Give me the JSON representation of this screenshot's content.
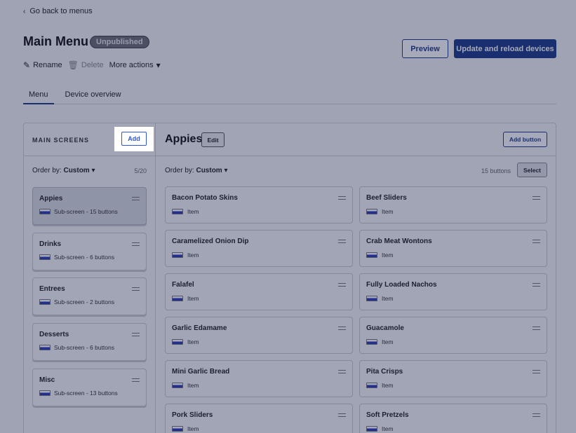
{
  "nav": {
    "back_label": "Go back to menus"
  },
  "header": {
    "title": "Main Menu",
    "status_badge": "Unpublished",
    "rename_label": "Rename",
    "delete_label": "Delete",
    "more_actions_label": "More actions",
    "preview_label": "Preview",
    "update_label": "Update and reload devices"
  },
  "tabs": [
    {
      "label": "Menu",
      "active": true
    },
    {
      "label": "Device overview",
      "active": false
    }
  ],
  "left_panel": {
    "heading": "MAIN SCREENS",
    "add_label": "Add",
    "order_prefix": "Order by:",
    "order_value": "Custom",
    "count": "5/20",
    "screens": [
      {
        "title": "Appies",
        "sub": "Sub-screen - 15 buttons",
        "selected": true
      },
      {
        "title": "Drinks",
        "sub": "Sub-screen - 6 buttons",
        "selected": false
      },
      {
        "title": "Entrees",
        "sub": "Sub-screen - 2 buttons",
        "selected": false
      },
      {
        "title": "Desserts",
        "sub": "Sub-screen - 6 buttons",
        "selected": false
      },
      {
        "title": "Misc",
        "sub": "Sub-screen - 13 buttons",
        "selected": false
      }
    ]
  },
  "right_panel": {
    "title": "Appies",
    "edit_label": "Edit",
    "add_button_label": "Add button",
    "order_prefix": "Order by:",
    "order_value": "Custom",
    "buttons_count": "15 buttons",
    "select_label": "Select",
    "items": [
      {
        "title": "Bacon Potato Skins",
        "sub": "Item"
      },
      {
        "title": "Beef Sliders",
        "sub": "Item"
      },
      {
        "title": "Caramelized Onion Dip",
        "sub": "Item"
      },
      {
        "title": "Crab Meat Wontons",
        "sub": "Item"
      },
      {
        "title": "Falafel",
        "sub": "Item"
      },
      {
        "title": "Fully Loaded Nachos",
        "sub": "Item"
      },
      {
        "title": "Garlic Edamame",
        "sub": "Item"
      },
      {
        "title": "Guacamole",
        "sub": "Item"
      },
      {
        "title": "Mini Garlic Bread",
        "sub": "Item"
      },
      {
        "title": "Pita Crisps",
        "sub": "Item"
      },
      {
        "title": "Pork Sliders",
        "sub": "Item"
      },
      {
        "title": "Soft Pretzels",
        "sub": "Item"
      }
    ]
  }
}
